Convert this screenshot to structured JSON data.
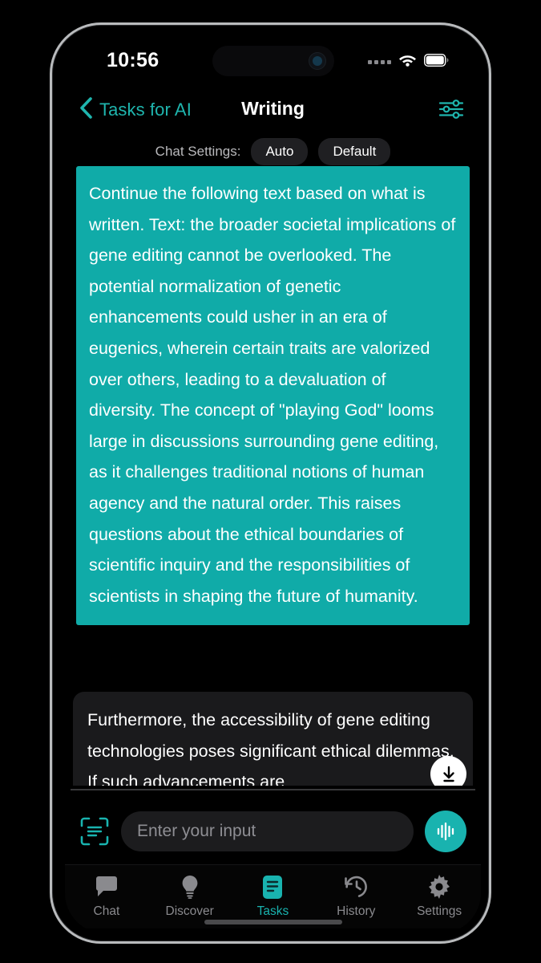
{
  "status_bar": {
    "time": "10:56",
    "icons": [
      "signal-dots",
      "wifi-icon",
      "battery-icon"
    ]
  },
  "nav": {
    "back_label": "Tasks for AI",
    "back_icon": "chevron-left-icon",
    "title": "Writing",
    "right_icon": "sliders-filter-icon"
  },
  "chat_settings": {
    "label": "Chat Settings:",
    "options": [
      {
        "label": "Auto"
      },
      {
        "label": "Default"
      }
    ]
  },
  "messages": {
    "user": {
      "text": "Continue the following text based on what is written. Text: the broader societal implications of gene editing cannot be overlooked. The potential normalization of genetic enhancements could usher in an era of eugenics, wherein certain traits are valorized over others, leading to a devaluation of diversity. The concept of \"playing God\" looms large in discussions surrounding gene editing, as it challenges traditional notions of human agency and the natural order. This raises questions about the ethical boundaries of scientific inquiry and the responsibilities of scientists in shaping the future of humanity.",
      "bubble_color": "#10aba8"
    },
    "assistant": {
      "text": "Furthermore, the accessibility of gene editing technologies poses significant ethical dilemmas. If such advancements are",
      "bubble_color": "#1a1a1c"
    },
    "scroll_button_icon": "arrow-down-to-line-icon"
  },
  "input": {
    "scan_icon": "scan-text-icon",
    "placeholder": "Enter your input",
    "value": "",
    "voice_icon": "voice-waveform-icon",
    "accent_color": "#19b3af"
  },
  "tabs": [
    {
      "label": "Chat",
      "icon": "chat-bubble-icon",
      "active": false
    },
    {
      "label": "Discover",
      "icon": "lightbulb-icon",
      "active": false
    },
    {
      "label": "Tasks",
      "icon": "document-lines-icon",
      "active": true
    },
    {
      "label": "History",
      "icon": "clock-rewind-icon",
      "active": false
    },
    {
      "label": "Settings",
      "icon": "gear-icon",
      "active": false
    }
  ],
  "theme": {
    "accent": "#19b3af",
    "background": "#000000",
    "surface": "#1a1a1c"
  }
}
